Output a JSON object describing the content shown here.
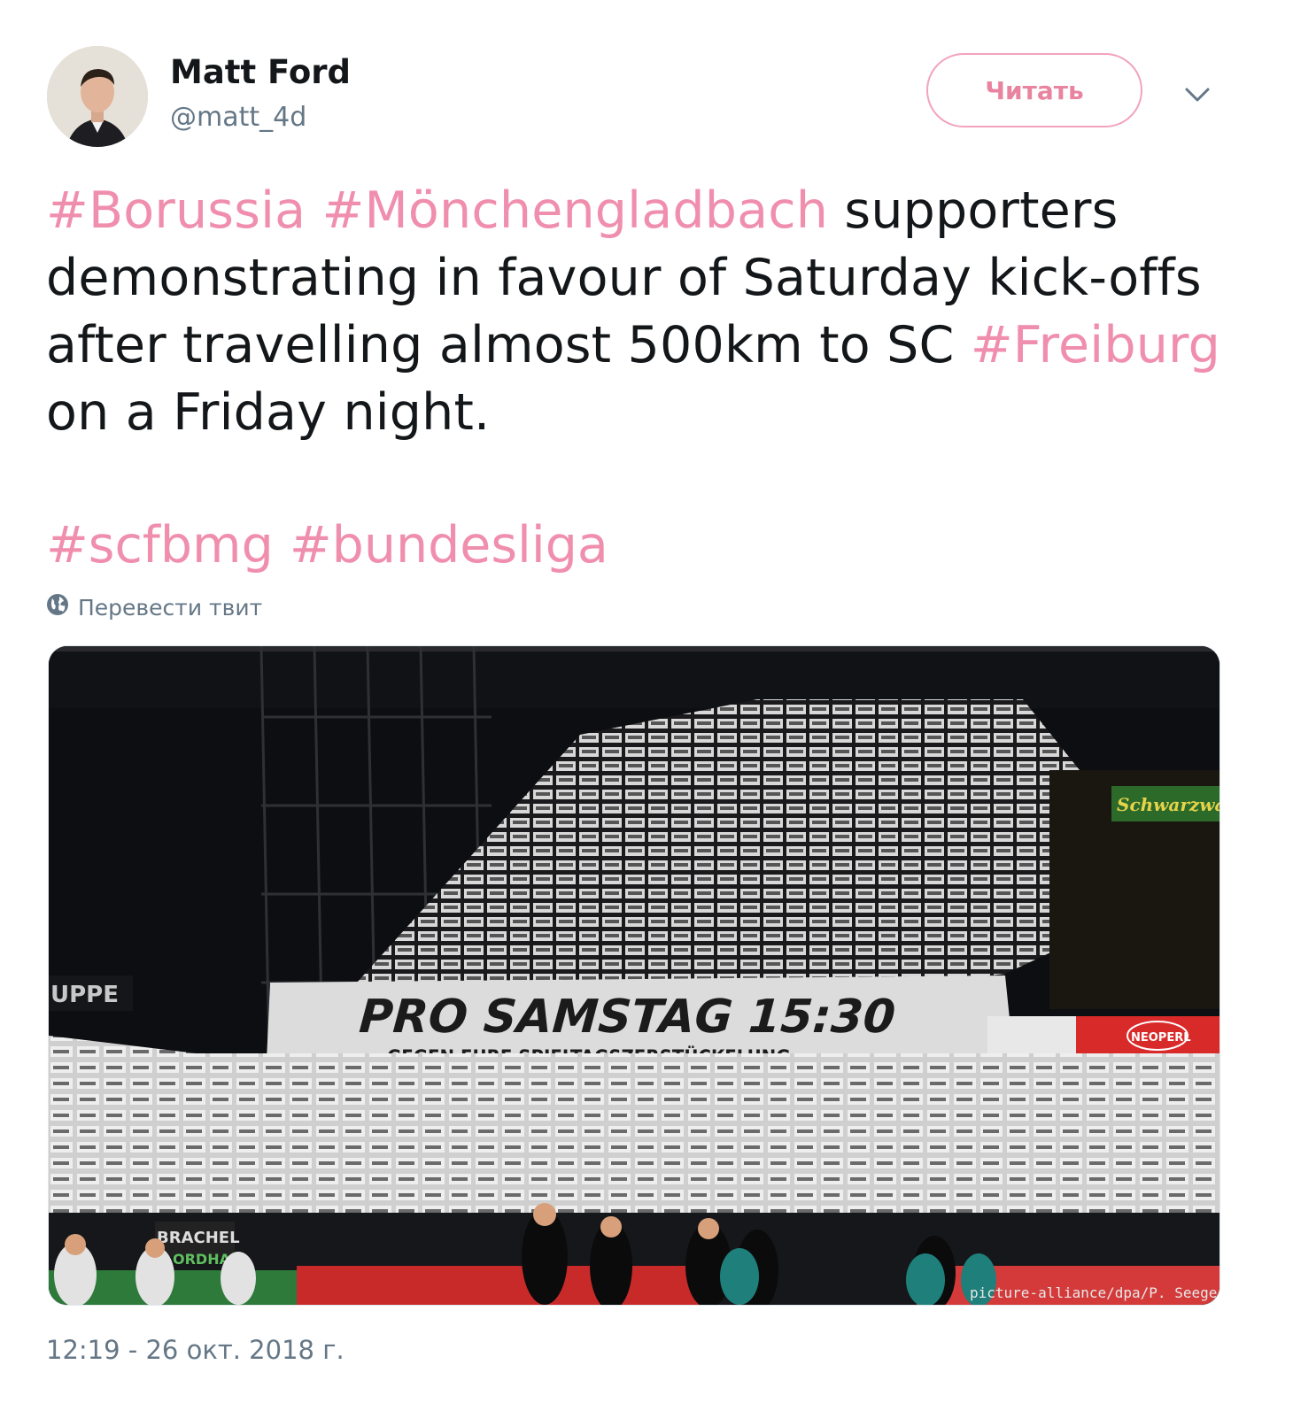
{
  "author": {
    "name": "Matt Ford",
    "handle": "@matt_4d"
  },
  "follow_button": {
    "label": "Читать"
  },
  "tweet": {
    "line1": {
      "tag1": "#Borussia",
      "tag2": "#Mönchengladbach",
      "text": " supporters"
    },
    "line2": "demonstrating in favour of Saturday kick-offs",
    "line3": {
      "text": "after travelling almost 500km to SC ",
      "tag": "#Freiburg"
    },
    "line4": "on a Friday night.",
    "hashtags": [
      "#scfbmg",
      "#bundesliga"
    ]
  },
  "translate_label": "Перевести твит",
  "media": {
    "banner_main": "PRO SAMSTAG 15:30",
    "banner_sub": "GEGEN EURE SPIELTAGSZERSTÜCKELUNG",
    "ad_right": "Schwarzwald",
    "sign_left": "UPPE",
    "ad_neopen": "NEOPERL",
    "ad_brachel": "BRACHEL",
    "ad_nordhau": "ORDHA",
    "credit": "picture-alliance/dpa/P. Seeger"
  },
  "timestamp": "12:19 - 26 окт. 2018 г.",
  "colors": {
    "hashtag": "#f08eae",
    "follow_border": "#f2a3bd",
    "secondary_text": "#657786"
  },
  "icons": {
    "caret": "chevron-down-icon",
    "translate": "globe-icon"
  }
}
